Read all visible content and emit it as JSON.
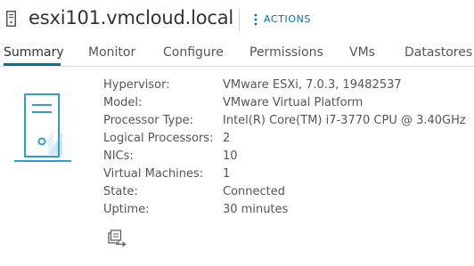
{
  "header": {
    "host_name": "esxi101.vmcloud.local",
    "host_icon": "server-icon",
    "actions_label": "ACTIONS",
    "actions_icon": "vertical-ellipsis-icon"
  },
  "tabs": [
    {
      "label": "Summary",
      "active": true
    },
    {
      "label": "Monitor",
      "active": false
    },
    {
      "label": "Configure",
      "active": false
    },
    {
      "label": "Permissions",
      "active": false
    },
    {
      "label": "VMs",
      "active": false
    },
    {
      "label": "Datastores",
      "active": false
    }
  ],
  "summary": {
    "illustration_icon": "host-server-icon",
    "properties": [
      {
        "label": "Hypervisor:",
        "value": "VMware ESXi, 7.0.3, 19482537"
      },
      {
        "label": "Model:",
        "value": "VMware Virtual Platform"
      },
      {
        "label": "Processor Type:",
        "value": "Intel(R) Core(TM) i7-3770 CPU @ 3.40GHz"
      },
      {
        "label": "Logical Processors:",
        "value": "2"
      },
      {
        "label": "NICs:",
        "value": "10"
      },
      {
        "label": "Virtual Machines:",
        "value": "1"
      },
      {
        "label": "State:",
        "value": "Connected"
      },
      {
        "label": "Uptime:",
        "value": "30 minutes"
      }
    ],
    "footer_icon": "vm-migrate-icon"
  },
  "colors": {
    "accent": "#0072a3",
    "text": "#565656",
    "title": "#333333",
    "illustration_stroke": "#2e9cd6",
    "illustration_fill": "#cfe6f5"
  }
}
